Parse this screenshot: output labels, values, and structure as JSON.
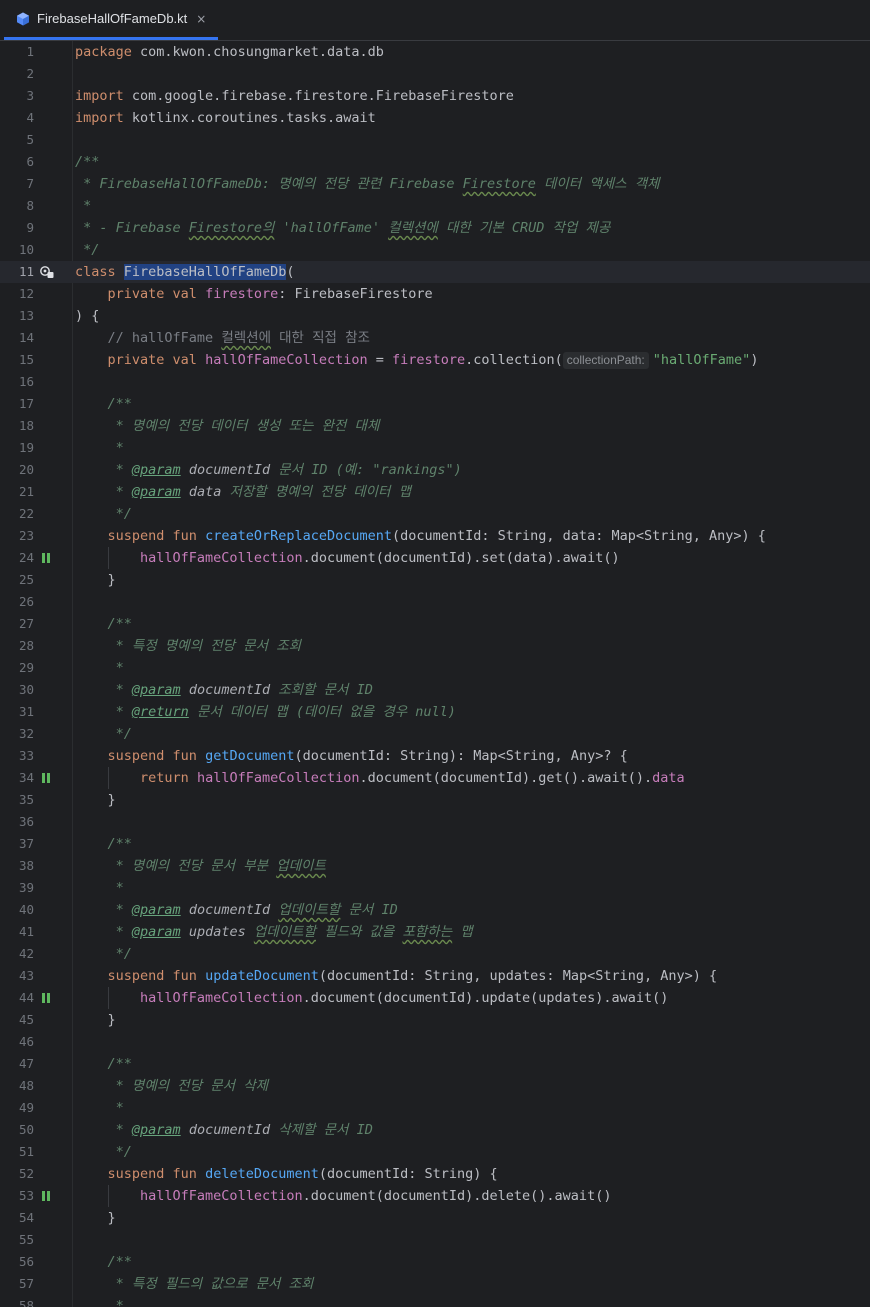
{
  "tab": {
    "title": "FirebaseHallOfFameDb.kt",
    "close": "×"
  },
  "gutter": {
    "current_line": 11
  },
  "lines": [
    {
      "n": "1",
      "tokens": [
        [
          "kw",
          "package"
        ],
        [
          "t",
          " com.kwon.chosungmarket.data.db"
        ]
      ]
    },
    {
      "n": "2",
      "tokens": []
    },
    {
      "n": "3",
      "tokens": [
        [
          "kw",
          "import"
        ],
        [
          "t",
          " com.google.firebase.firestore.FirebaseFirestore"
        ]
      ]
    },
    {
      "n": "4",
      "tokens": [
        [
          "kw",
          "import"
        ],
        [
          "t",
          " kotlinx.coroutines.tasks.await"
        ]
      ]
    },
    {
      "n": "5",
      "tokens": []
    },
    {
      "n": "6",
      "tokens": [
        [
          "doc",
          "/**"
        ]
      ]
    },
    {
      "n": "7",
      "tokens": [
        [
          "doc",
          " * FirebaseHallOfFameDb: 명예의 전당 관련 Firebase "
        ],
        [
          "doc",
          "Firestore",
          "typo"
        ],
        [
          "doc",
          " 데이터 액세스 객체"
        ]
      ]
    },
    {
      "n": "8",
      "tokens": [
        [
          "doc",
          " *"
        ]
      ]
    },
    {
      "n": "9",
      "tokens": [
        [
          "doc",
          " * - Firebase "
        ],
        [
          "doc",
          "Firestore의",
          "typo"
        ],
        [
          "doc",
          " 'hallOfFame' "
        ],
        [
          "doc",
          "컬렉션에",
          "typo"
        ],
        [
          "doc",
          " 대한 기본 CRUD 작업 제공"
        ]
      ]
    },
    {
      "n": "10",
      "tokens": [
        [
          "doc",
          " */"
        ]
      ]
    },
    {
      "n": "11",
      "tokens": [
        [
          "kw",
          "class "
        ],
        [
          "sel",
          "FirebaseHallOfFameDb"
        ],
        [
          "t",
          "("
        ]
      ],
      "icon": "run-gutter-icon",
      "current": true
    },
    {
      "n": "12",
      "tokens": [
        [
          "t",
          "    "
        ],
        [
          "kw",
          "private val "
        ],
        [
          "pr",
          "firestore"
        ],
        [
          "t",
          ": FirebaseFirestore"
        ]
      ]
    },
    {
      "n": "13",
      "tokens": [
        [
          "t",
          ") {"
        ]
      ]
    },
    {
      "n": "14",
      "tokens": [
        [
          "t",
          "    "
        ],
        [
          "cm",
          "// hallOfFame "
        ],
        [
          "cm",
          "컬렉션에",
          "typo"
        ],
        [
          "cm",
          " 대한 직접 참조"
        ]
      ]
    },
    {
      "n": "15",
      "tokens": [
        [
          "t",
          "    "
        ],
        [
          "kw",
          "private val "
        ],
        [
          "pr",
          "hallOfFameCollection"
        ],
        [
          "t",
          " = "
        ],
        [
          "pr",
          "firestore"
        ],
        [
          "t",
          ".collection("
        ],
        [
          "hint",
          "collectionPath:"
        ],
        [
          "st",
          "\"hallOfFame\""
        ],
        [
          "t",
          ")"
        ]
      ]
    },
    {
      "n": "16",
      "tokens": []
    },
    {
      "n": "17",
      "tokens": [
        [
          "t",
          "    "
        ],
        [
          "doc",
          "/**"
        ]
      ]
    },
    {
      "n": "18",
      "tokens": [
        [
          "t",
          "    "
        ],
        [
          "doc",
          " * 명예의 전당 데이터 생성 또는 완전 대체"
        ]
      ]
    },
    {
      "n": "19",
      "tokens": [
        [
          "t",
          "    "
        ],
        [
          "doc",
          " *"
        ]
      ]
    },
    {
      "n": "20",
      "tokens": [
        [
          "t",
          "    "
        ],
        [
          "doc",
          " * "
        ],
        [
          "tag",
          "@param"
        ],
        [
          "t",
          " "
        ],
        [
          "pname",
          "documentId"
        ],
        [
          "doc",
          " 문서 ID (예: \"rankings\")"
        ]
      ]
    },
    {
      "n": "21",
      "tokens": [
        [
          "t",
          "    "
        ],
        [
          "doc",
          " * "
        ],
        [
          "tag",
          "@param"
        ],
        [
          "t",
          " "
        ],
        [
          "pname",
          "data"
        ],
        [
          "doc",
          " 저장할 명예의 전당 데이터 맵"
        ]
      ]
    },
    {
      "n": "22",
      "tokens": [
        [
          "t",
          "    "
        ],
        [
          "doc",
          " */"
        ]
      ]
    },
    {
      "n": "23",
      "tokens": [
        [
          "t",
          "    "
        ],
        [
          "kw",
          "suspend fun "
        ],
        [
          "fn",
          "createOrReplaceDocument"
        ],
        [
          "t",
          "(documentId: String, data: Map<String, Any>) {"
        ]
      ]
    },
    {
      "n": "24",
      "tokens": [
        [
          "t",
          "        "
        ],
        [
          "pr",
          "hallOfFameCollection"
        ],
        [
          "t",
          ".document(documentId).set(data).await()"
        ]
      ],
      "icon": "suspend-call-icon"
    },
    {
      "n": "25",
      "tokens": [
        [
          "t",
          "    }"
        ]
      ]
    },
    {
      "n": "26",
      "tokens": []
    },
    {
      "n": "27",
      "tokens": [
        [
          "t",
          "    "
        ],
        [
          "doc",
          "/**"
        ]
      ]
    },
    {
      "n": "28",
      "tokens": [
        [
          "t",
          "    "
        ],
        [
          "doc",
          " * 특정 명예의 전당 문서 조회"
        ]
      ]
    },
    {
      "n": "29",
      "tokens": [
        [
          "t",
          "    "
        ],
        [
          "doc",
          " *"
        ]
      ]
    },
    {
      "n": "30",
      "tokens": [
        [
          "t",
          "    "
        ],
        [
          "doc",
          " * "
        ],
        [
          "tag",
          "@param"
        ],
        [
          "t",
          " "
        ],
        [
          "pname",
          "documentId"
        ],
        [
          "doc",
          " 조회할 문서 ID"
        ]
      ]
    },
    {
      "n": "31",
      "tokens": [
        [
          "t",
          "    "
        ],
        [
          "doc",
          " * "
        ],
        [
          "tag",
          "@return"
        ],
        [
          "doc",
          " 문서 데이터 맵 (데이터 없을 경우 null)"
        ]
      ]
    },
    {
      "n": "32",
      "tokens": [
        [
          "t",
          "    "
        ],
        [
          "doc",
          " */"
        ]
      ]
    },
    {
      "n": "33",
      "tokens": [
        [
          "t",
          "    "
        ],
        [
          "kw",
          "suspend fun "
        ],
        [
          "fn",
          "getDocument"
        ],
        [
          "t",
          "(documentId: String): Map<String, Any>? {"
        ]
      ]
    },
    {
      "n": "34",
      "tokens": [
        [
          "t",
          "        "
        ],
        [
          "kw",
          "return "
        ],
        [
          "pr",
          "hallOfFameCollection"
        ],
        [
          "t",
          ".document(documentId).get().await()."
        ],
        [
          "pr",
          "data"
        ]
      ],
      "icon": "suspend-call-icon"
    },
    {
      "n": "35",
      "tokens": [
        [
          "t",
          "    }"
        ]
      ]
    },
    {
      "n": "36",
      "tokens": []
    },
    {
      "n": "37",
      "tokens": [
        [
          "t",
          "    "
        ],
        [
          "doc",
          "/**"
        ]
      ]
    },
    {
      "n": "38",
      "tokens": [
        [
          "t",
          "    "
        ],
        [
          "doc",
          " * 명예의 전당 문서 부분 "
        ],
        [
          "doc",
          "업데이트",
          "typo"
        ]
      ]
    },
    {
      "n": "39",
      "tokens": [
        [
          "t",
          "    "
        ],
        [
          "doc",
          " *"
        ]
      ]
    },
    {
      "n": "40",
      "tokens": [
        [
          "t",
          "    "
        ],
        [
          "doc",
          " * "
        ],
        [
          "tag",
          "@param"
        ],
        [
          "t",
          " "
        ],
        [
          "pname",
          "documentId"
        ],
        [
          "doc",
          " "
        ],
        [
          "doc",
          "업데이트할",
          "typo"
        ],
        [
          "doc",
          " 문서 ID"
        ]
      ]
    },
    {
      "n": "41",
      "tokens": [
        [
          "t",
          "    "
        ],
        [
          "doc",
          " * "
        ],
        [
          "tag",
          "@param"
        ],
        [
          "t",
          " "
        ],
        [
          "pname",
          "updates"
        ],
        [
          "doc",
          " "
        ],
        [
          "doc",
          "업데이트할",
          "typo"
        ],
        [
          "doc",
          " 필드와 값을 "
        ],
        [
          "doc",
          "포함하는",
          "typo"
        ],
        [
          "doc",
          " 맵"
        ]
      ]
    },
    {
      "n": "42",
      "tokens": [
        [
          "t",
          "    "
        ],
        [
          "doc",
          " */"
        ]
      ]
    },
    {
      "n": "43",
      "tokens": [
        [
          "t",
          "    "
        ],
        [
          "kw",
          "suspend fun "
        ],
        [
          "fn",
          "updateDocument"
        ],
        [
          "t",
          "(documentId: String, updates: Map<String, Any>) {"
        ]
      ]
    },
    {
      "n": "44",
      "tokens": [
        [
          "t",
          "        "
        ],
        [
          "pr",
          "hallOfFameCollection"
        ],
        [
          "t",
          ".document(documentId).update(updates).await()"
        ]
      ],
      "icon": "suspend-call-icon"
    },
    {
      "n": "45",
      "tokens": [
        [
          "t",
          "    }"
        ]
      ]
    },
    {
      "n": "46",
      "tokens": []
    },
    {
      "n": "47",
      "tokens": [
        [
          "t",
          "    "
        ],
        [
          "doc",
          "/**"
        ]
      ]
    },
    {
      "n": "48",
      "tokens": [
        [
          "t",
          "    "
        ],
        [
          "doc",
          " * 명예의 전당 문서 삭제"
        ]
      ]
    },
    {
      "n": "49",
      "tokens": [
        [
          "t",
          "    "
        ],
        [
          "doc",
          " *"
        ]
      ]
    },
    {
      "n": "50",
      "tokens": [
        [
          "t",
          "    "
        ],
        [
          "doc",
          " * "
        ],
        [
          "tag",
          "@param"
        ],
        [
          "t",
          " "
        ],
        [
          "pname",
          "documentId"
        ],
        [
          "doc",
          " 삭제할 문서 ID"
        ]
      ]
    },
    {
      "n": "51",
      "tokens": [
        [
          "t",
          "    "
        ],
        [
          "doc",
          " */"
        ]
      ]
    },
    {
      "n": "52",
      "tokens": [
        [
          "t",
          "    "
        ],
        [
          "kw",
          "suspend fun "
        ],
        [
          "fn",
          "deleteDocument"
        ],
        [
          "t",
          "(documentId: String) {"
        ]
      ]
    },
    {
      "n": "53",
      "tokens": [
        [
          "t",
          "        "
        ],
        [
          "pr",
          "hallOfFameCollection"
        ],
        [
          "t",
          ".document(documentId).delete().await()"
        ]
      ],
      "icon": "suspend-call-icon"
    },
    {
      "n": "54",
      "tokens": [
        [
          "t",
          "    }"
        ]
      ]
    },
    {
      "n": "55",
      "tokens": []
    },
    {
      "n": "56",
      "tokens": [
        [
          "t",
          "    "
        ],
        [
          "doc",
          "/**"
        ]
      ]
    },
    {
      "n": "57",
      "tokens": [
        [
          "t",
          "    "
        ],
        [
          "doc",
          " * 특정 필드의 값으로 문서 조회"
        ]
      ]
    },
    {
      "n": "58",
      "tokens": [
        [
          "t",
          "    "
        ],
        [
          "doc",
          " *"
        ]
      ]
    }
  ],
  "colors": {
    "background": "#1e1f22",
    "keyword": "#cf8e6d",
    "property": "#c77dbb",
    "function": "#56a8f5",
    "string": "#6aab73",
    "doc_comment": "#5f826b",
    "selection": "#214283",
    "suspend_icon": "#5fb85f"
  }
}
